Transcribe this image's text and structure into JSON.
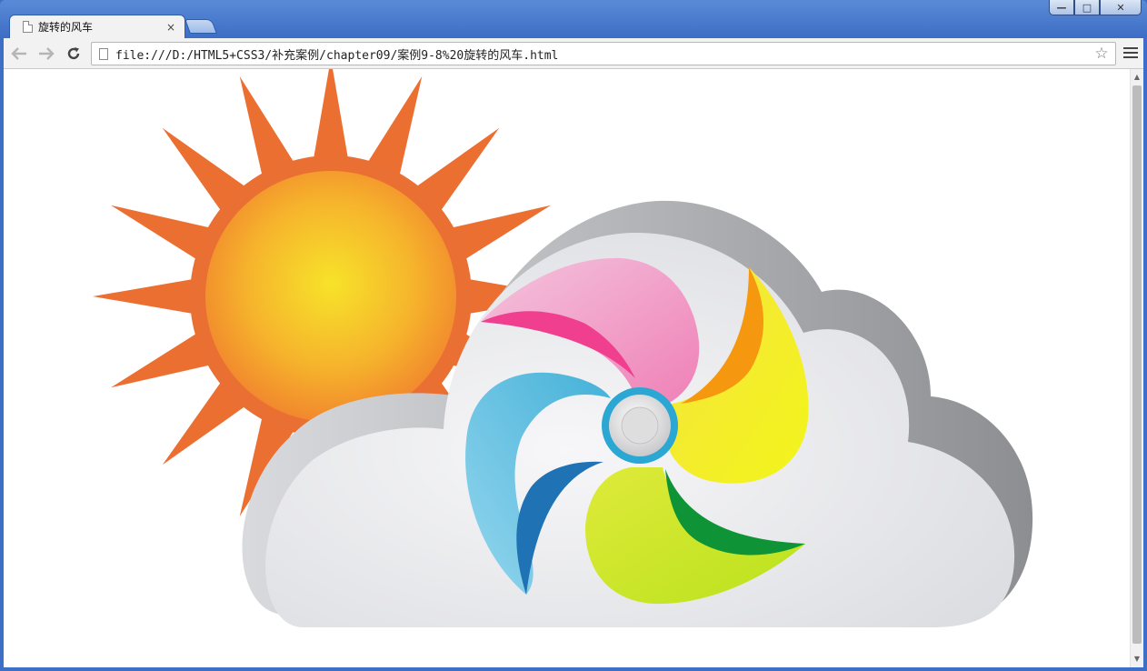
{
  "window": {
    "controls": {
      "minimize": "—",
      "maximize": "□",
      "close": "✕"
    }
  },
  "tab": {
    "title": "旋转的风车",
    "close_label": "×",
    "icon": "page-icon"
  },
  "toolbar": {
    "back_icon": "back-arrow-icon",
    "forward_icon": "forward-arrow-icon",
    "reload_icon": "reload-icon",
    "url": "file:///D:/HTML5+CSS3/补充案例/chapter09/案例9-8%20旋转的风车.html",
    "bookmark_icon": "star-icon",
    "menu_icon": "hamburger-menu-icon"
  },
  "page": {
    "illustration": "sun-cloud-pinwheel",
    "colors": {
      "sun_rays": "#ec6f32",
      "sun_center": "#f7e32a",
      "sun_edge": "#f28a2c",
      "cloud": "#e8e9ed",
      "cloud_shadow": "#9d9ea2",
      "blade_pink": "#f178b4",
      "blade_yellow": "#f4ea1c",
      "blade_green": "#c7e51e",
      "blade_blue": "#5bbbe0",
      "hub": "#2aa7d2"
    }
  }
}
